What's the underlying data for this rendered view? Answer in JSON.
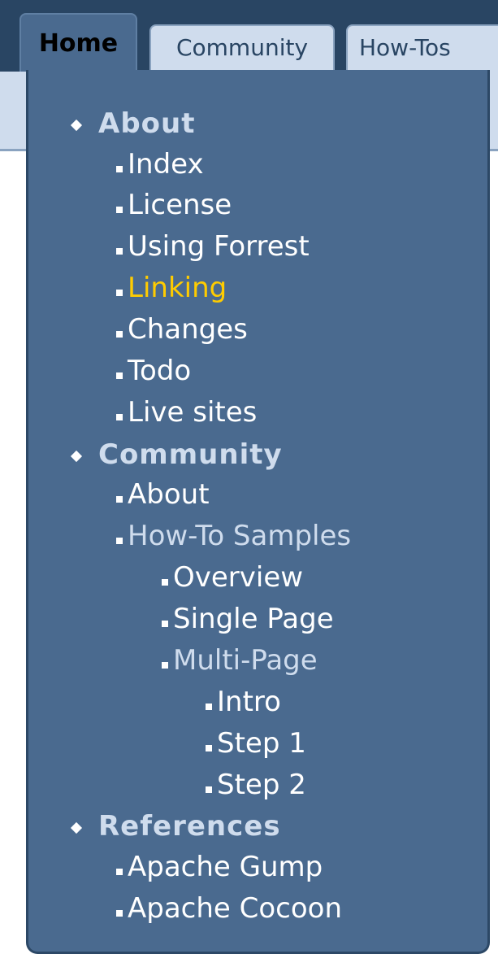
{
  "tabs": [
    {
      "label": "Home",
      "active": true
    },
    {
      "label": "Community",
      "active": false
    },
    {
      "label": "How-Tos",
      "active": false
    }
  ],
  "menu": {
    "groups": [
      {
        "label": "About",
        "items": [
          {
            "label": "Index"
          },
          {
            "label": "License"
          },
          {
            "label": "Using Forrest"
          },
          {
            "label": "Linking",
            "state": "selected"
          },
          {
            "label": "Changes"
          },
          {
            "label": "Todo"
          },
          {
            "label": "Live sites"
          }
        ]
      },
      {
        "label": "Community",
        "items": [
          {
            "label": "About"
          },
          {
            "label": "How-To Samples",
            "state": "expanded",
            "children": [
              {
                "label": "Overview"
              },
              {
                "label": "Single Page"
              },
              {
                "label": "Multi-Page",
                "state": "expanded",
                "children": [
                  {
                    "label": "Intro"
                  },
                  {
                    "label": "Step 1"
                  },
                  {
                    "label": "Step 2"
                  }
                ]
              }
            ]
          }
        ]
      },
      {
        "label": "References",
        "items": [
          {
            "label": "Apache Gump"
          },
          {
            "label": "Apache Cocoon"
          }
        ]
      }
    ]
  },
  "colors": {
    "header_bg": "#294563",
    "panel_bg": "#4a6a8f",
    "inactive_tab_bg": "#cfdced",
    "selected_link": "#ffcc00",
    "expanded_link": "#cfdced",
    "link": "#ffffff"
  }
}
